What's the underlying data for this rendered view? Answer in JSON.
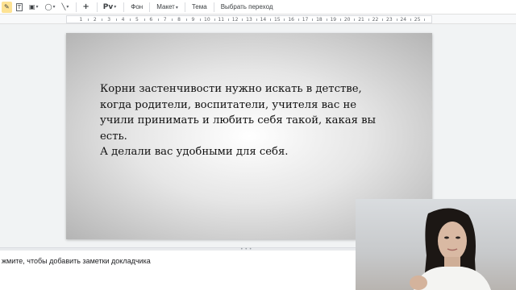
{
  "toolbar": {
    "tools": [
      {
        "icon": "pencil-icon",
        "glyph": "✎",
        "active": true
      },
      {
        "icon": "textbox-icon",
        "glyph": "T"
      },
      {
        "icon": "image-icon",
        "glyph": "▣"
      },
      {
        "icon": "shape-icon",
        "glyph": "◯"
      },
      {
        "icon": "line-icon",
        "glyph": "╲"
      },
      {
        "icon": "new-comment-icon",
        "glyph": "+"
      }
    ],
    "font_label": "Pv",
    "background_label": "Фон",
    "layout_label": "Макет",
    "theme_label": "Тема",
    "transition_label": "Выбрать переход"
  },
  "ruler": {
    "numbers": [
      "1",
      "2",
      "3",
      "4",
      "5",
      "6",
      "7",
      "8",
      "9",
      "10",
      "11",
      "12",
      "13",
      "14",
      "15",
      "16",
      "17",
      "18",
      "19",
      "20",
      "21",
      "22",
      "23",
      "24",
      "25"
    ]
  },
  "slide": {
    "lines": [
      "Корни застенчивости нужно искать в детстве,",
      "когда родители, воспитатели, учителя вас не",
      "учили принимать и любить себя такой, какая вы",
      "есть.",
      "А делали вас удобными для себя."
    ]
  },
  "notes": {
    "placeholder": "жмите, чтобы добавить заметки докладчика"
  }
}
